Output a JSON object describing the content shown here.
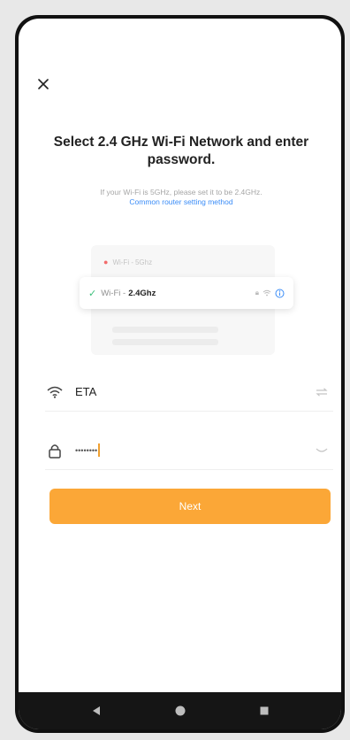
{
  "status": {
    "left": "",
    "right": ""
  },
  "header": {
    "close_icon": "close-icon"
  },
  "main": {
    "title": "Select 2.4 GHz Wi-Fi Network and enter password.",
    "subtitle": "If your Wi-Fi is 5GHz, please set it to be 2.4GHz.",
    "link": "Common router setting method"
  },
  "illustration": {
    "row_5g": {
      "name": "Wi-Fi - ",
      "band": "5Ghz"
    },
    "row_24g": {
      "name": "Wi-Fi - ",
      "band": "2.4Ghz"
    }
  },
  "form": {
    "ssid": {
      "icon": "wifi-icon",
      "value": "ETA",
      "action_icon": "switch-network-icon"
    },
    "password": {
      "icon": "lock-icon",
      "value": "••••••••",
      "action_icon": "eye-closed-icon"
    }
  },
  "actions": {
    "next_label": "Next"
  },
  "navbar": {
    "items": [
      "back-icon",
      "home-icon",
      "recents-icon"
    ]
  },
  "colors": {
    "accent": "#fba737",
    "link": "#3a8cf7",
    "check": "#3bbf7b"
  }
}
